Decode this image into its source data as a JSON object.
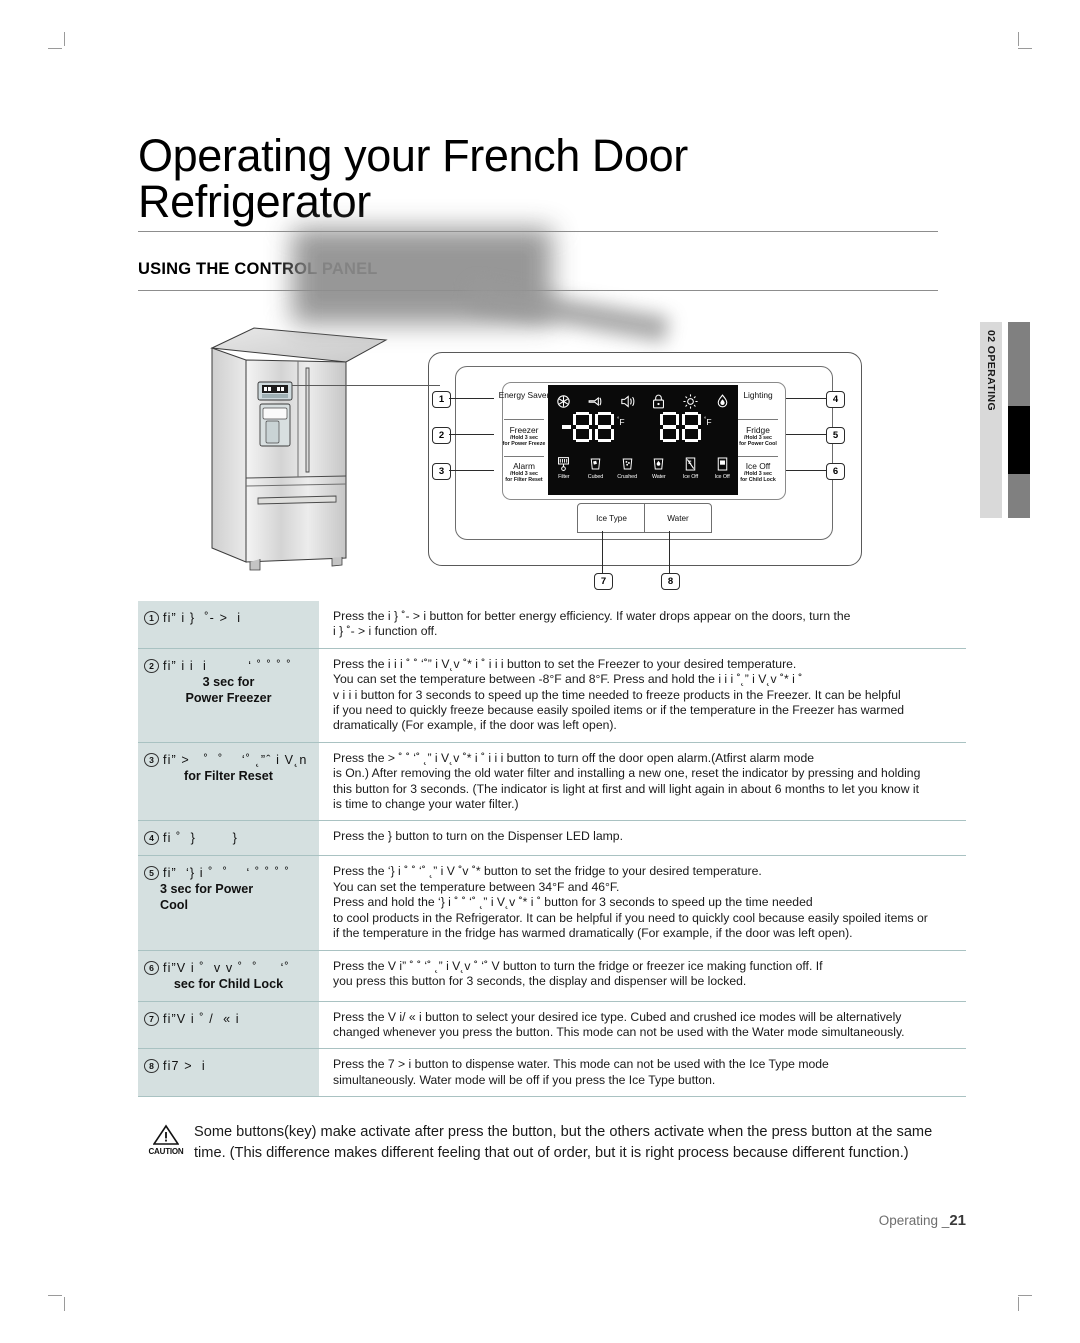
{
  "document": {
    "title_line1": "Operating your French Door",
    "title_line2": "Refrigerator",
    "section_heading": "USING THE CONTROL PANEL",
    "side_tab": "02 OPERATING",
    "footer_label": "Operating _",
    "footer_page": "21"
  },
  "control_panel": {
    "left_buttons": [
      {
        "callout": "1",
        "name": "Energy Saver",
        "hold": ""
      },
      {
        "callout": "2",
        "name": "Freezer",
        "hold": "/Hold 3 sec\nfor Power Freeze"
      },
      {
        "callout": "3",
        "name": "Alarm",
        "hold": "/Hold 3 sec\nfor Filter Reset"
      }
    ],
    "right_buttons": [
      {
        "callout": "4",
        "name": "Lighting",
        "hold": ""
      },
      {
        "callout": "5",
        "name": "Fridge",
        "hold": "/Hold 3 sec\nfor Power Cool"
      },
      {
        "callout": "6",
        "name": "Ice Off",
        "hold": "/Hold 3 sec\nfor Child Lock"
      }
    ],
    "bottom_buttons": [
      {
        "callout": "7",
        "name": "Ice Type"
      },
      {
        "callout": "8",
        "name": "Water"
      }
    ],
    "status_icons_top": [
      "power-freeze-icon",
      "power-cool-icon",
      "sound-icon",
      "child-lock-icon",
      "lamp-icon",
      "water-filter-icon"
    ],
    "indicator_icons_bottom": [
      {
        "icon": "filter-icon",
        "label": "Filter"
      },
      {
        "icon": "cubed-ice-icon",
        "label": "Cubed"
      },
      {
        "icon": "crushed-ice-icon",
        "label": "Crushed"
      },
      {
        "icon": "water-glass-icon",
        "label": "Water"
      },
      {
        "icon": "ice-off-icon",
        "label": "Ice Off"
      },
      {
        "icon": "ice-off-alt-icon",
        "label": "Ice Off"
      }
    ],
    "display": {
      "freezer_sign": "-",
      "freezer_value": "88",
      "freezer_unit": "F",
      "fridge_value": "88",
      "fridge_unit": "F"
    }
  },
  "table": {
    "rows": [
      {
        "num": "1",
        "label_garbled": "fi” i }  ˚- >  i",
        "label_bold": "",
        "body": "Press the      i }  ˚- >  i  button for better energy efficiency. If water drops appear on the doors, turn the\n   i }  ˚- >  i function off."
      },
      {
        "num": "2",
        "label_garbled": "fi” i i  i         ‘ ˚ ˚ ˚ ˚",
        "label_bold": "3 sec for\nPower Freezer",
        "body": "Press the      i i  i  ˚ ˚    ‘˚” i V˛v  ˚*   i   ˚  i i  i  button to set the Freezer to your desired temperature.\nYou can set the temperature between -8°F and 8°F. Press and hold the      i i  i       ˚˛” i V˛v  ˚*   i  ˚\n v  i i  i button for 3 seconds to speed up the time needed to freeze products in the Freezer.  It can be helpful\nif you need to quickly freeze because easily spoiled items or if the temperature in the Freezer has warmed\ndramatically (For example, if the door was left open)."
      },
      {
        "num": "3",
        "label_garbled": "fi” >   ˚  ˚    ‘˚ ˛”ˆ i V˛n",
        "label_bold": "for Filter Reset",
        "body": "Press the    >   ˚ ˚    ‘˚ ˛” i V˛v  ˚*   i   ˚  i i  i  button to turn off the door open alarm.(Atfirst alarm mode\nis On.) After removing the old water filter and installing a new one, reset the indicator by pressing and holding\nthis button for 3 seconds. (The indicator is light at first and will light again in about 6 months to let you know it\nis time to change your water filter.)"
      },
      {
        "num": "4",
        "label_garbled": "fi ˚  }        }",
        "label_bold": "",
        "body": "Press the      }        button to turn on the Dispenser LED lamp."
      },
      {
        "num": "5",
        "label_garbled": "fi”  ‘} i ˚  ˚    ‘ ˚ ˚ ˚ ˚",
        "label_bold": "3 sec for Power\nCool",
        "body": "Press the       ‘} i ˚  ˚     ‘˚ ˛” i V ˚v   ˚*     button to set the fridge to your desired temperature.\nYou can set the temperature between 34°F and 46°F.\nPress and hold the        ‘} i ˚ ˚    ‘˚ ˛” i V˛v  ˚*   i  ˚         button for 3 seconds to speed up the time needed\nto cool products in the Refrigerator. It can be helpful if you need to quickly cool because easily spoiled items or\nif the temperature in the fridge has warmed dramatically (For example, if the door was left open)."
      },
      {
        "num": "6",
        "label_garbled": "fi”V i ˚  v v ˚  ˚     ‘˚",
        "label_bold": "sec for Child Lock",
        "body": "Press the     V i”    ˚ ˚     ‘˚ ˛” i V˛v  ˚      ‘˚  V button to turn the fridge or freezer ice making function off. If\nyou press this button for 3 seconds, the display and dispenser will be locked."
      },
      {
        "num": "7",
        "label_garbled": "fi”V i ˚ /  « i",
        "label_bold": "",
        "body": "Press the    V i/  « i button to select your desired ice type. Cubed and crushed ice modes will be alternatively\nchanged whenever you press the button. This mode can not be used with the Water mode simultaneously."
      },
      {
        "num": "8",
        "label_garbled": "fi7 >  i",
        "label_bold": "",
        "body": "Press the  7 >   i button to dispense water. This mode can not be used with the Ice Type mode\nsimultaneously. Water mode will be off if you press the Ice Type button."
      }
    ]
  },
  "caution": {
    "icon_label": "CAUTION",
    "text": "Some buttons(key) make activate after press the button, but the others activate when the press button at the same time. (This difference makes different feeling that out of order, but it is right process because different function.)"
  }
}
